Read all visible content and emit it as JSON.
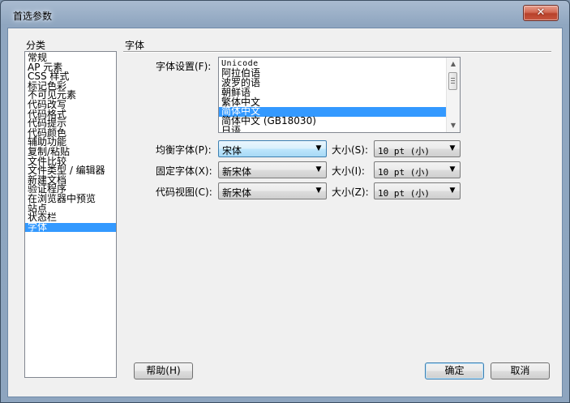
{
  "window": {
    "title": "首选参数",
    "close_glyph": "✕"
  },
  "categories": {
    "label": "分类",
    "items": [
      "常规",
      "AP 元素",
      "CSS 样式",
      "标记色彩",
      "不可见元素",
      "代码改写",
      "代码格式",
      "代码提示",
      "代码颜色",
      "辅助功能",
      "复制/粘贴",
      "文件比较",
      "文件类型 / 编辑器",
      "新建文档",
      "验证程序",
      "在浏览器中预览",
      "站点",
      "状态栏",
      "字体"
    ],
    "selected_index": 18
  },
  "panel": {
    "title": "字体",
    "font_settings_label": "字体设置(F):",
    "font_list": {
      "items": [
        "Unicode",
        "阿拉伯语",
        "波罗的语",
        "朝鲜语",
        "繁体中文",
        "简体中文",
        "简体中文 (GB18030)",
        "日语"
      ],
      "selected_index": 5
    },
    "proportional": {
      "label": "均衡字体(P):",
      "value": "宋体",
      "size_label": "大小(S):",
      "size_value": "10 pt (小)"
    },
    "fixed": {
      "label": "固定字体(X):",
      "value": "新宋体",
      "size_label": "大小(I):",
      "size_value": "10 pt (小)"
    },
    "code_view": {
      "label": "代码视图(C):",
      "value": "新宋体",
      "size_label": "大小(Z):",
      "size_value": "10 pt (小)"
    }
  },
  "buttons": {
    "help": "帮助(H)",
    "ok": "确定",
    "cancel": "取消"
  },
  "glyphs": {
    "dropdown_arrow": "▼",
    "scroll_up": "▲",
    "scroll_down": "▼"
  }
}
